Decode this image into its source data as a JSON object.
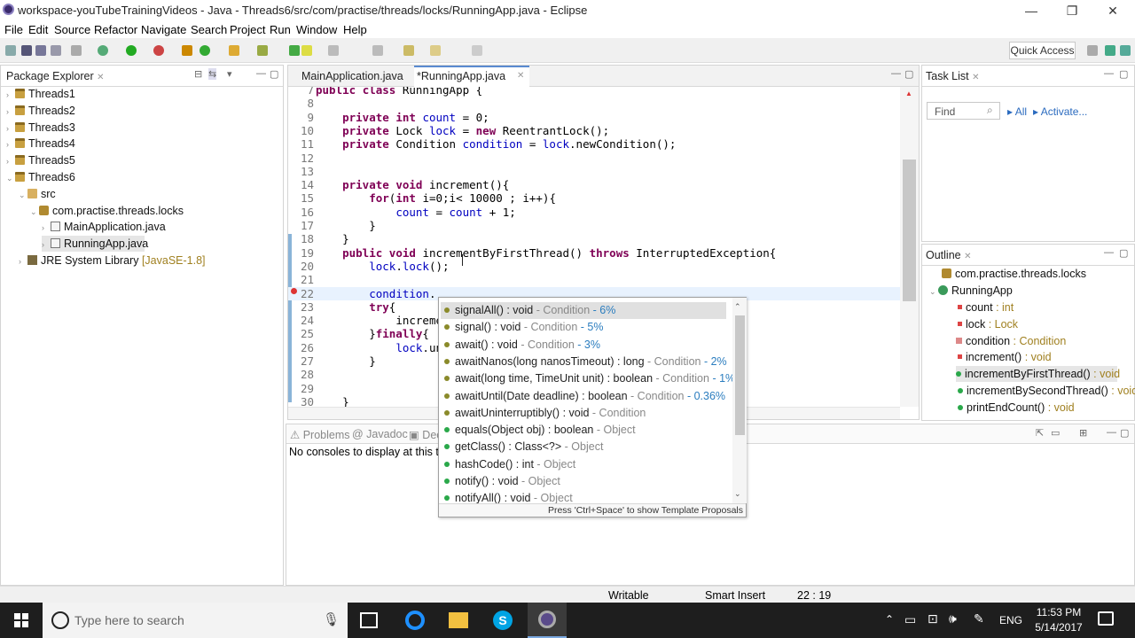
{
  "window": {
    "title": "workspace-youTubeTrainingVideos - Java - Threads6/src/com/practise/threads/locks/RunningApp.java - Eclipse",
    "controls": [
      "—",
      "❐",
      "✕"
    ]
  },
  "menu": [
    "File",
    "Edit",
    "Source",
    "Refactor",
    "Navigate",
    "Search",
    "Project",
    "Run",
    "Window",
    "Help"
  ],
  "toolbar": {
    "quick_access": "Quick Access"
  },
  "package_explorer": {
    "title": "Package Explorer",
    "items": [
      {
        "label": "Threads1",
        "extra": ""
      },
      {
        "label": "Threads2",
        "extra": ""
      },
      {
        "label": "Threads3",
        "extra": ""
      },
      {
        "label": "Threads4",
        "extra": ""
      },
      {
        "label": "Threads5",
        "extra": ""
      },
      {
        "label": "Threads6",
        "extra": ""
      },
      {
        "label": "src",
        "extra": ""
      },
      {
        "label": "com.practise.threads.locks",
        "extra": ""
      },
      {
        "label": "MainApplication.java",
        "extra": ""
      },
      {
        "label": "RunningApp.java",
        "extra": ""
      },
      {
        "label": "JRE System Library",
        "extra": "[JavaSE-1.8]"
      }
    ]
  },
  "editor": {
    "tabs": [
      {
        "label": "MainApplication.java"
      },
      {
        "label": "*RunningApp.java"
      }
    ],
    "lines": [
      {
        "n": "7",
        "text": "public class RunningApp {"
      },
      {
        "n": "8",
        "text": ""
      },
      {
        "n": "9",
        "text": "    private int count = 0;"
      },
      {
        "n": "10",
        "text": "    private Lock lock = new ReentrantLock();"
      },
      {
        "n": "11",
        "text": "    private Condition condition = lock.newCondition();"
      },
      {
        "n": "12",
        "text": ""
      },
      {
        "n": "13",
        "text": ""
      },
      {
        "n": "14",
        "text": "    private void increment(){"
      },
      {
        "n": "15",
        "text": "        for(int i=0;i< 10000 ; i++){"
      },
      {
        "n": "16",
        "text": "            count = count + 1;"
      },
      {
        "n": "17",
        "text": "        }"
      },
      {
        "n": "18",
        "text": "    }"
      },
      {
        "n": "19",
        "text": "    public void incrementByFirstThread() throws InterruptedException{"
      },
      {
        "n": "20",
        "text": "        lock.lock();"
      },
      {
        "n": "21",
        "text": ""
      },
      {
        "n": "22",
        "text": "        condition."
      },
      {
        "n": "23",
        "text": "        try{"
      },
      {
        "n": "24",
        "text": "            increme"
      },
      {
        "n": "25",
        "text": "        }finally{"
      },
      {
        "n": "26",
        "text": "            lock.un"
      },
      {
        "n": "27",
        "text": "        }"
      },
      {
        "n": "28",
        "text": ""
      },
      {
        "n": "29",
        "text": ""
      },
      {
        "n": "30",
        "text": "    }"
      }
    ]
  },
  "autocomplete": {
    "items": [
      {
        "name": "signalAll() : void",
        "owner": " - Condition",
        "pct": " - 6%"
      },
      {
        "name": "signal() : void",
        "owner": " - Condition",
        "pct": " - 5%"
      },
      {
        "name": "await() : void",
        "owner": " - Condition",
        "pct": " - 3%"
      },
      {
        "name": "awaitNanos(long nanosTimeout) : long",
        "owner": " - Condition",
        "pct": " - 2%"
      },
      {
        "name": "await(long time, TimeUnit unit) : boolean",
        "owner": " - Condition",
        "pct": " - 1%"
      },
      {
        "name": "awaitUntil(Date deadline) : boolean",
        "owner": " - Condition",
        "pct": " - 0.36%"
      },
      {
        "name": "awaitUninterruptibly() : void",
        "owner": " - Condition",
        "pct": ""
      },
      {
        "name": "equals(Object obj) : boolean",
        "owner": " - Object",
        "pct": ""
      },
      {
        "name": "getClass() : Class<?>",
        "owner": " - Object",
        "pct": ""
      },
      {
        "name": "hashCode() : int",
        "owner": " - Object",
        "pct": ""
      },
      {
        "name": "notify() : void",
        "owner": " - Object",
        "pct": ""
      },
      {
        "name": "notifyAll() : void",
        "owner": " - Object",
        "pct": ""
      }
    ],
    "hint": "Press 'Ctrl+Space' to show Template Proposals"
  },
  "task_list": {
    "title": "Task List",
    "find_placeholder": "Find",
    "all": "All",
    "activate": "Activate..."
  },
  "outline": {
    "title": "Outline",
    "items": [
      {
        "label": "com.practise.threads.locks",
        "type": ""
      },
      {
        "label": "RunningApp",
        "type": ""
      },
      {
        "label": "count",
        "type": " : int"
      },
      {
        "label": "lock",
        "type": " : Lock"
      },
      {
        "label": "condition",
        "type": " : Condition"
      },
      {
        "label": "increment()",
        "type": " : void"
      },
      {
        "label": "incrementByFirstThread()",
        "type": " : void"
      },
      {
        "label": "incrementBySecondThread()",
        "type": " : void"
      },
      {
        "label": "printEndCount()",
        "type": " : void"
      }
    ]
  },
  "bottom": {
    "tabs": [
      "Problems",
      "Javadoc",
      "Decl"
    ],
    "message": "No consoles to display at this tim"
  },
  "status": {
    "writable": "Writable",
    "mode": "Smart Insert",
    "position": "22 : 19"
  },
  "taskbar": {
    "search_placeholder": "Type here to search",
    "lang": "ENG",
    "time": "11:53 PM",
    "date": "5/14/2017"
  },
  "colors": {
    "keyword": "#7f0055",
    "field": "#0000c0",
    "percent": "#2b7dbf",
    "type_hint": "#a08020"
  }
}
